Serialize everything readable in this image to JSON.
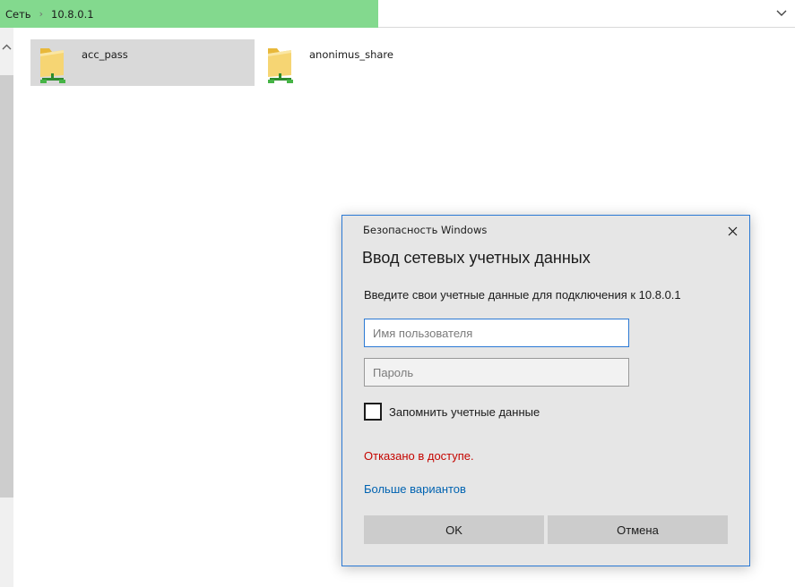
{
  "addressbar": {
    "crumbs": [
      "Сеть",
      "10.8.0.1"
    ],
    "accent_color": "#83d98e",
    "dropdown_icon": "chevron-down-icon"
  },
  "folders": [
    {
      "name": "acc_pass",
      "selected": true,
      "icon": "network-share-folder-icon"
    },
    {
      "name": "anonimus_share",
      "selected": false,
      "icon": "network-share-folder-icon"
    }
  ],
  "dialog": {
    "caption": "Безопасность Windows",
    "title": "Ввод сетевых учетных данных",
    "subtitle": "Введите свои учетные данные для подключения к 10.8.0.1",
    "username_placeholder": "Имя пользователя",
    "password_placeholder": "Пароль",
    "remember_label": "Запомнить учетные данные",
    "remember_checked": false,
    "error": "Отказано в доступе.",
    "error_color": "#c50500",
    "more_options": "Больше вариантов",
    "link_color": "#0063b1",
    "ok": "OK",
    "cancel": "Отмена",
    "border_color": "#2b79d4"
  }
}
